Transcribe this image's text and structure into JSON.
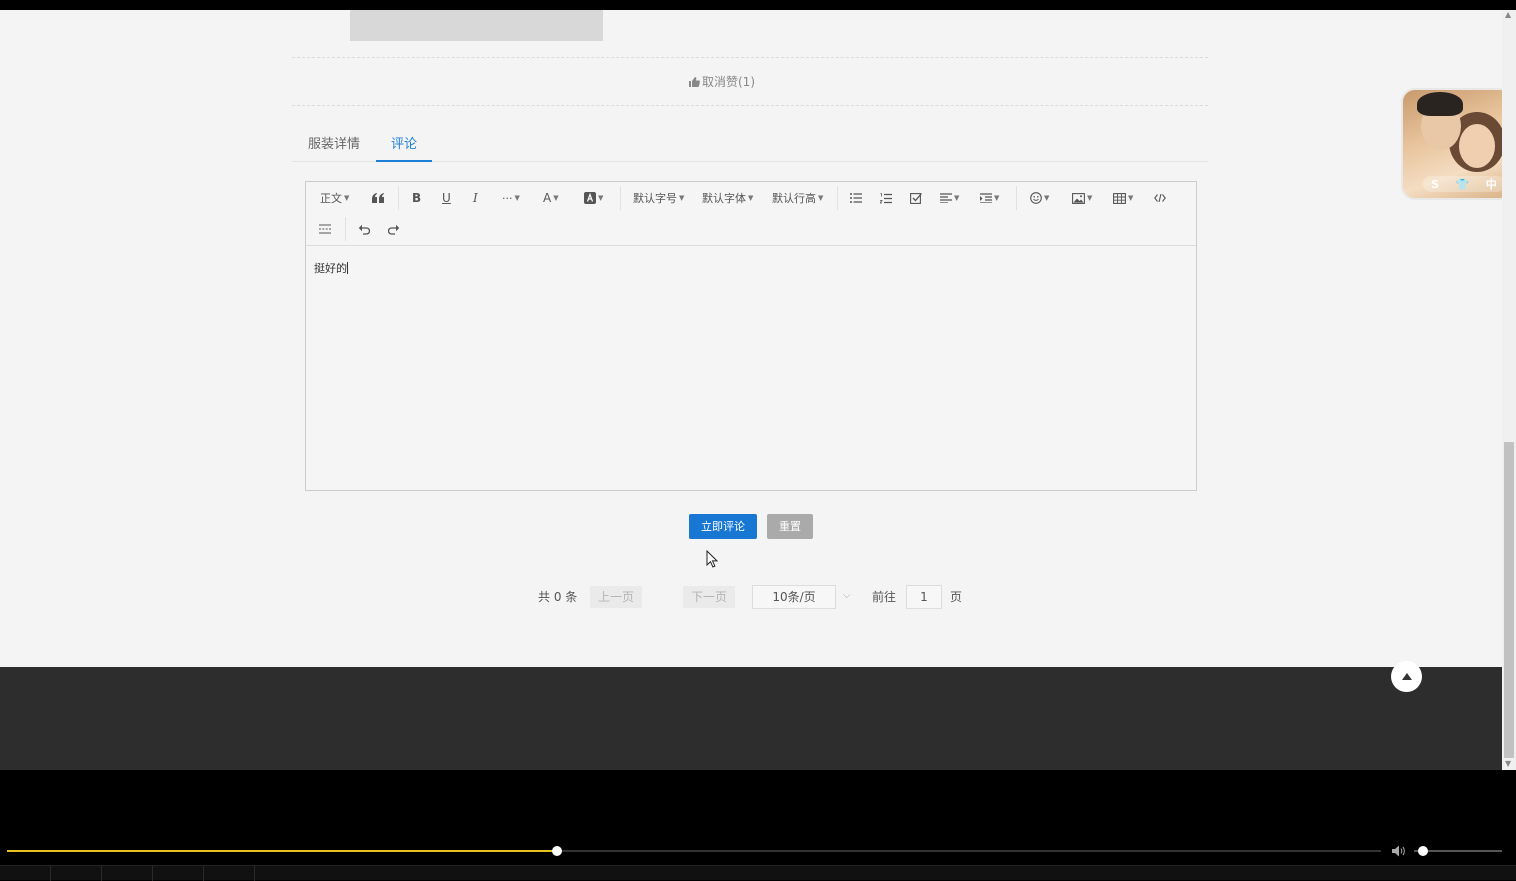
{
  "like": {
    "label": "取消赞(1)"
  },
  "tabs": [
    {
      "label": "服装详情",
      "active": false
    },
    {
      "label": "评论",
      "active": true
    }
  ],
  "editor": {
    "toolbar": {
      "paragraph": "正文",
      "font_size": "默认字号",
      "font_family": "默认字体",
      "line_height": "默认行高"
    },
    "content": "挺好的"
  },
  "actions": {
    "submit_label": "立即评论",
    "reset_label": "重置"
  },
  "pagination": {
    "total_text": "共 0 条",
    "prev_label": "上一页",
    "next_label": "下一页",
    "page_size": "10条/页",
    "goto_label": "前往",
    "current_page": "1",
    "page_unit": "页"
  },
  "player": {
    "progress": 0.4,
    "volume": 0.1
  },
  "colors": {
    "accent": "#1777d2",
    "progress": "#e8c21c",
    "footer": "#2d2d2d"
  }
}
